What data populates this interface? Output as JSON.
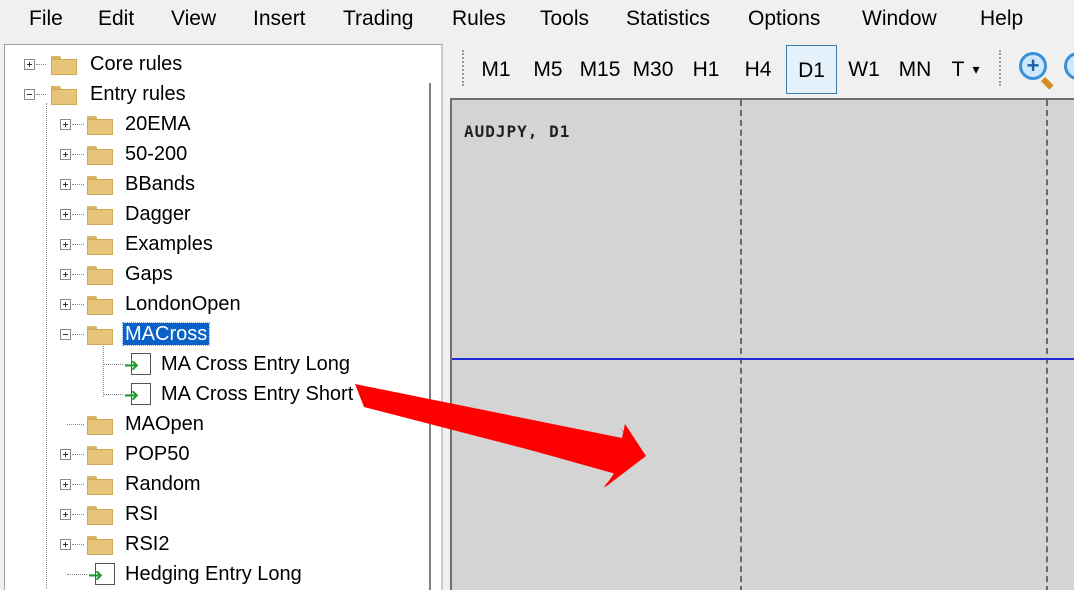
{
  "menu": [
    "File",
    "Edit",
    "View",
    "Insert",
    "Trading",
    "Rules",
    "Tools",
    "Statistics",
    "Options",
    "Window",
    "Help"
  ],
  "tree": {
    "items": [
      {
        "label": "Core rules",
        "type": "folder",
        "expander": "plus",
        "selected": false
      },
      {
        "label": "Entry rules",
        "type": "folder",
        "expander": "minus",
        "selected": false
      },
      {
        "label": "20EMA",
        "type": "folder",
        "expander": "plus",
        "selected": false
      },
      {
        "label": "50-200",
        "type": "folder",
        "expander": "plus",
        "selected": false
      },
      {
        "label": "BBands",
        "type": "folder",
        "expander": "plus",
        "selected": false
      },
      {
        "label": "Dagger",
        "type": "folder",
        "expander": "plus",
        "selected": false
      },
      {
        "label": "Examples",
        "type": "folder",
        "expander": "plus",
        "selected": false
      },
      {
        "label": "Gaps",
        "type": "folder",
        "expander": "plus",
        "selected": false
      },
      {
        "label": "LondonOpen",
        "type": "folder",
        "expander": "plus",
        "selected": false
      },
      {
        "label": "MACross",
        "type": "folder",
        "expander": "minus",
        "selected": true
      },
      {
        "label": "MA Cross Entry Long",
        "type": "rule",
        "expander": "none",
        "selected": false
      },
      {
        "label": "MA Cross Entry Short",
        "type": "rule",
        "expander": "none",
        "selected": false
      },
      {
        "label": "MAOpen",
        "type": "folder",
        "expander": "none",
        "selected": false
      },
      {
        "label": "POP50",
        "type": "folder",
        "expander": "plus",
        "selected": false
      },
      {
        "label": "Random",
        "type": "folder",
        "expander": "plus",
        "selected": false
      },
      {
        "label": "RSI",
        "type": "folder",
        "expander": "plus",
        "selected": false
      },
      {
        "label": "RSI2",
        "type": "folder",
        "expander": "plus",
        "selected": false
      },
      {
        "label": "Hedging Entry Long",
        "type": "rule",
        "expander": "none",
        "selected": false
      }
    ]
  },
  "toolbar": {
    "timeframes": [
      "M1",
      "M5",
      "M15",
      "M30",
      "H1",
      "H4",
      "D1",
      "W1",
      "MN",
      "T"
    ],
    "active_timeframe": "D1",
    "dropdown_indicator": "▾",
    "zoom_in_glyph": "+"
  },
  "chart": {
    "symbol_label": "AUDJPY, D1",
    "background_color": "#d4d4d4",
    "price_line_color": "#1f2bd8"
  },
  "annotation": {
    "arrow_color": "#ff0000"
  }
}
